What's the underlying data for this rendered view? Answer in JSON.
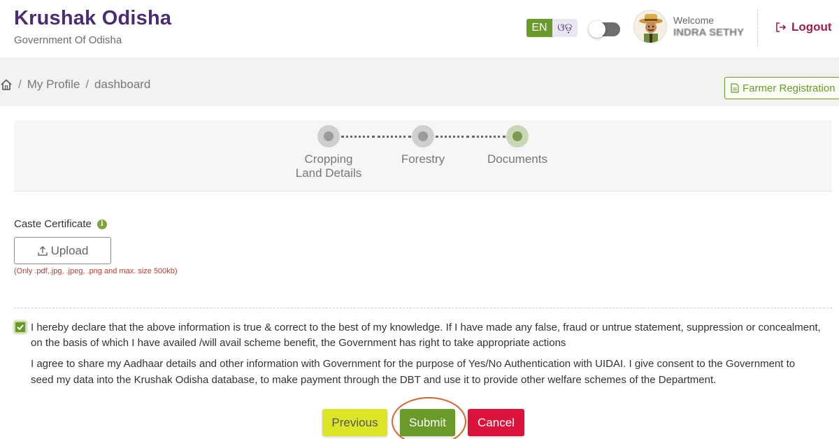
{
  "header": {
    "title": "Krushak Odisha",
    "subtitle": "Government Of Odisha",
    "lang_en": "EN",
    "lang_or": "ଓଡ଼",
    "welcome": "Welcome",
    "username": "INDRA SETHY",
    "logout_label": "Logout"
  },
  "breadcrumb": {
    "items": [
      "My Profile",
      "dashboard"
    ],
    "separator": "/",
    "farmer_registration_label": "Farmer Registration"
  },
  "stepper": {
    "steps": [
      {
        "line1": "Cropping",
        "line2": "Land Details",
        "status": "completed"
      },
      {
        "line1": "Forestry",
        "line2": "",
        "status": "completed"
      },
      {
        "line1": "Documents",
        "line2": "",
        "status": "active"
      }
    ]
  },
  "form": {
    "caste_label": "Caste Certificate",
    "upload_label": "Upload",
    "upload_hint": "(Only .pdf,.jpg, .jpeg, .png and max. size 500kb)",
    "declaration_checked": true,
    "declaration_1": "I hereby declare that the above information is true & correct to the best of my knowledge. If I have made any false, fraud or untrue statement, suppression or concealment, on the basis of which I have availed /will avail scheme benefit, the Government has right to take appropriate actions",
    "declaration_2": "I agree to share my Aadhaar details and other information with Government for the purpose of Yes/No Authentication with UIDAI. I give consent to the Government to seed my data into the Krushak Odisha database, to make payment through the DBT and use it to provide other welfare schemes of the Department."
  },
  "actions": {
    "previous": "Previous",
    "submit": "Submit",
    "cancel": "Cancel"
  },
  "colors": {
    "brand": "#4a2c73",
    "accent_green": "#6a9a2a",
    "logout": "#a01d4f",
    "cancel": "#dc143c",
    "previous": "#dce626"
  },
  "icons": [
    "home-icon",
    "upload-icon",
    "info-icon",
    "logout-icon",
    "document-icon",
    "check-icon"
  ]
}
